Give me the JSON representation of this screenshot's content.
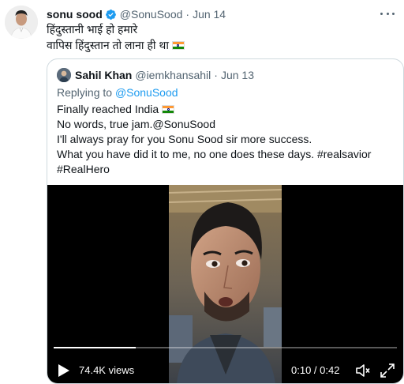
{
  "tweet": {
    "author_name": "sonu sood",
    "author_handle": "@SonuSood",
    "separator": "·",
    "date": "Jun 14",
    "text_line1": "हिंदुस्तानी भाई हो हमारे",
    "text_line2": "वापिस हिंदुस्तान तो लाना ही था",
    "icons": {
      "avatar": "profile-photo",
      "verified": "verified-badge-icon",
      "more": "more-options-icon",
      "flag": "india-flag-icon"
    },
    "colors": {
      "verified": "#1d9bf0",
      "muted": "#536471",
      "border": "#cfd9de"
    }
  },
  "quoted": {
    "author_name": "Sahil Khan",
    "author_handle": "@iemkhansahil",
    "separator": "·",
    "date": "Jun 13",
    "replying_label": "Replying to",
    "replying_to": "@SonuSood",
    "lines": [
      "Finally reached India",
      "No words, true jam.@SonuSood",
      "I'll always pray for you Sonu Sood sir more success.",
      "What you have did it to me, no one does these days. #realsavior",
      "#RealHero"
    ]
  },
  "video": {
    "views": "74.4K views",
    "time": "0:10 / 0:42",
    "progress": 0.24,
    "icons": {
      "play": "play-icon",
      "volume": "volume-icon",
      "fullscreen": "fullscreen-icon"
    }
  }
}
